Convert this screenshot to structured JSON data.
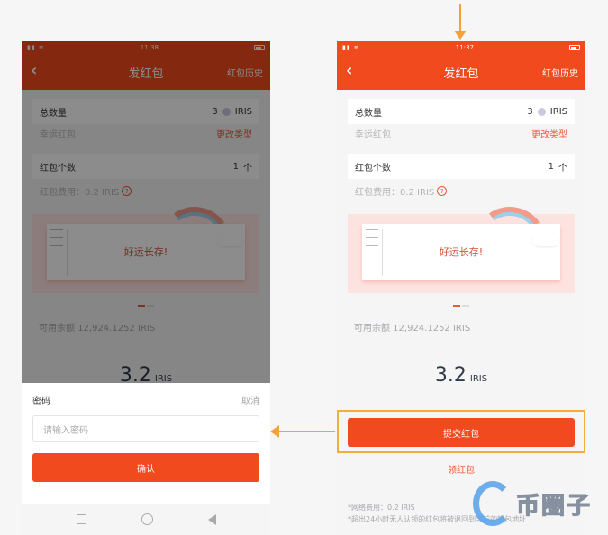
{
  "left_screen": {
    "status": {
      "time": "11:38",
      "signal": "ᴴᴵ ◠"
    },
    "nav": {
      "back": "‹",
      "title": "发红包",
      "history": "红包历史"
    },
    "total": {
      "label": "总数量",
      "value": "3",
      "unit": "IRIS"
    },
    "type": {
      "label": "幸运红包",
      "change": "更改类型"
    },
    "count": {
      "label": "红包个数",
      "value": "1",
      "unit": "个"
    },
    "fee": "红包费用：0.2 IRIS",
    "banner_text": "好运长存!",
    "balance": "可用余额 12,924.1252 IRIS",
    "amount": {
      "num": "3.2",
      "unit": "IRIS"
    },
    "password_sheet": {
      "title": "密码",
      "cancel": "取消",
      "placeholder": "请输入密码",
      "confirm": "确认"
    }
  },
  "right_screen": {
    "status": {
      "time": "11:37"
    },
    "nav": {
      "back": "‹",
      "title": "发红包",
      "history": "红包历史"
    },
    "total": {
      "label": "总数量",
      "value": "3",
      "unit": "IRIS"
    },
    "type": {
      "label": "幸运红包",
      "change": "更改类型"
    },
    "count": {
      "label": "红包个数",
      "value": "1",
      "unit": "个"
    },
    "fee": "红包费用：0.2 IRIS",
    "banner_text": "好运长存!",
    "balance": "可用余额 12,924.1252 IRIS",
    "amount": {
      "num": "3.2",
      "unit": "IRIS"
    },
    "submit": "提交红包",
    "receive": "领红包",
    "notes": [
      "*网络费用：0.2 IRIS",
      "*超出24小时无人认领的红包将被退回到当前的钱包地址"
    ]
  },
  "watermark": {
    "text": "币圈子"
  },
  "colors": {
    "accent": "#f04a1e",
    "highlight": "#f3ad3c",
    "link": "#ea5a3d"
  }
}
